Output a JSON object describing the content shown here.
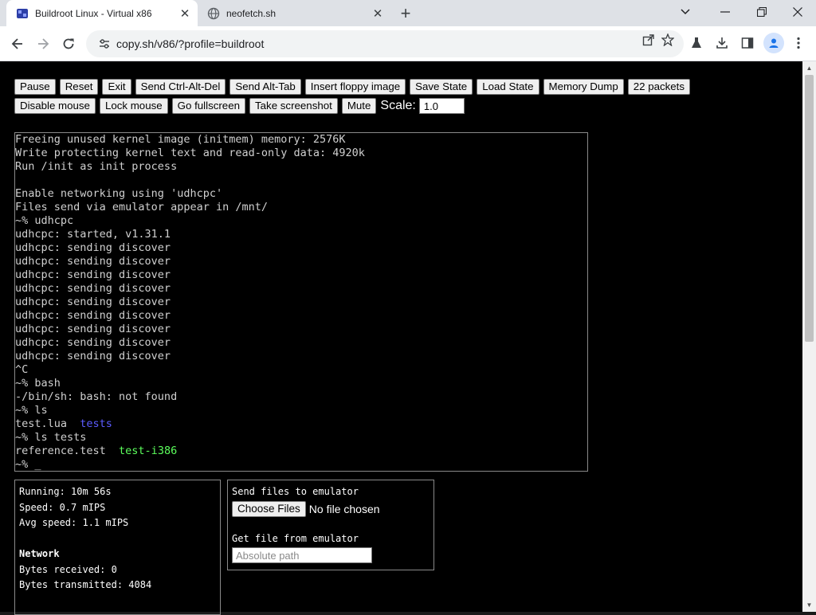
{
  "browser": {
    "tabs": [
      {
        "title": "Buildroot Linux - Virtual x86",
        "active": true,
        "favicon": "v86-logo-icon"
      },
      {
        "title": "neofetch.sh",
        "active": false,
        "favicon": "globe-icon"
      }
    ],
    "url": "copy.sh/v86/?profile=buildroot",
    "accent": "#1a73e8"
  },
  "controls": {
    "row1": [
      "Pause",
      "Reset",
      "Exit",
      "Send Ctrl-Alt-Del",
      "Send Alt-Tab",
      "Insert floppy image",
      "Save State",
      "Load State",
      "Memory Dump",
      "22 packets"
    ],
    "row2": [
      "Disable mouse",
      "Lock mouse",
      "Go fullscreen",
      "Take screenshot",
      "Mute"
    ],
    "scale_label": "Scale:",
    "scale_value": "1.0"
  },
  "terminal": {
    "lines": [
      [
        {
          "text": "Freeing unused kernel image (initmem) memory: 2576K"
        }
      ],
      [
        {
          "text": "Write protecting kernel text and read-only data: 4920k"
        }
      ],
      [
        {
          "text": "Run /init as init process"
        }
      ],
      [
        {
          "text": ""
        }
      ],
      [
        {
          "text": "Enable networking using 'udhcpc'"
        }
      ],
      [
        {
          "text": "Files send via emulator appear in /mnt/"
        }
      ],
      [
        {
          "text": "~% udhcpc"
        }
      ],
      [
        {
          "text": "udhcpc: started, v1.31.1"
        }
      ],
      [
        {
          "text": "udhcpc: sending discover"
        }
      ],
      [
        {
          "text": "udhcpc: sending discover"
        }
      ],
      [
        {
          "text": "udhcpc: sending discover"
        }
      ],
      [
        {
          "text": "udhcpc: sending discover"
        }
      ],
      [
        {
          "text": "udhcpc: sending discover"
        }
      ],
      [
        {
          "text": "udhcpc: sending discover"
        }
      ],
      [
        {
          "text": "udhcpc: sending discover"
        }
      ],
      [
        {
          "text": "udhcpc: sending discover"
        }
      ],
      [
        {
          "text": "udhcpc: sending discover"
        }
      ],
      [
        {
          "text": "^C"
        }
      ],
      [
        {
          "text": "~% bash"
        }
      ],
      [
        {
          "text": "-/bin/sh: bash: not found"
        }
      ],
      [
        {
          "text": "~% ls"
        }
      ],
      [
        {
          "text": "test.lua  "
        },
        {
          "text": "tests",
          "color": "blue"
        }
      ],
      [
        {
          "text": "~% ls tests"
        }
      ],
      [
        {
          "text": "reference.test  "
        },
        {
          "text": "test-i386",
          "color": "green"
        }
      ],
      [
        {
          "text": "~% _"
        }
      ]
    ]
  },
  "stats": {
    "running": "Running: 10m 56s",
    "speed": "Speed: 0.7 mIPS",
    "avg_speed": "Avg speed: 1.1 mIPS",
    "network_heading": "Network",
    "bytes_received": "Bytes received: 0",
    "bytes_transmitted": "Bytes transmitted: 4084"
  },
  "files": {
    "send_label": "Send files to emulator",
    "choose_button": "Choose Files",
    "no_file": "No file chosen",
    "get_label": "Get file from emulator",
    "path_placeholder": "Absolute path"
  }
}
